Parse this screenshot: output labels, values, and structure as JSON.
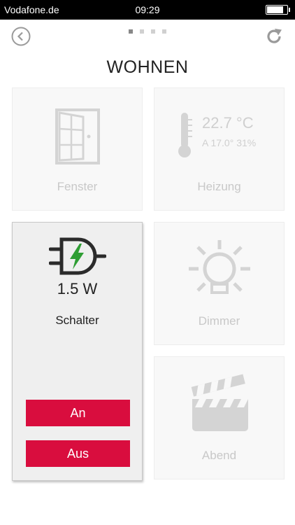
{
  "statusbar": {
    "carrier": "Vodafone.de",
    "time": "09:29",
    "battery_level": 0.9
  },
  "page": {
    "title": "WOHNEN",
    "indicator_count": 4,
    "indicator_active": 1
  },
  "tiles": {
    "fenster": {
      "label": "Fenster",
      "icon": "window-icon"
    },
    "heizung": {
      "label": "Heizung",
      "icon": "thermometer-icon",
      "temperature": "22.7 °C",
      "details": "A 17.0° 31%"
    },
    "schalter": {
      "label": "Schalter",
      "icon": "plug-icon",
      "power": "1.5 W",
      "on_label": "An",
      "off_label": "Aus"
    },
    "dimmer": {
      "label": "Dimmer",
      "icon": "lightbulb-icon"
    },
    "abend": {
      "label": "Abend",
      "icon": "clapperboard-icon"
    }
  },
  "colors": {
    "accent_red": "#d90d3e",
    "plug_green": "#2f9e34",
    "inactive_gray": "#c8c8c8"
  }
}
